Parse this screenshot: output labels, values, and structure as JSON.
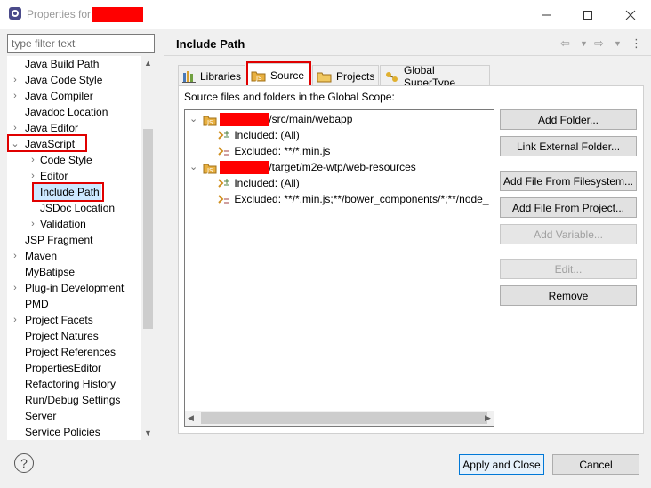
{
  "window": {
    "title": "Properties for",
    "minimize_icon": "minimize-icon",
    "maximize_icon": "maximize-icon",
    "close_icon": "close-icon"
  },
  "filter": {
    "placeholder": "type filter text"
  },
  "tree": {
    "items": [
      {
        "label": "Java Build Path",
        "expander": ""
      },
      {
        "label": "Java Code Style",
        "expander": ">"
      },
      {
        "label": "Java Compiler",
        "expander": ">"
      },
      {
        "label": "Javadoc Location",
        "expander": ""
      },
      {
        "label": "Java Editor",
        "expander": ">"
      },
      {
        "label": "JavaScript",
        "expander": "v",
        "highlighted": true
      },
      {
        "label": "Code Style",
        "expander": ">"
      },
      {
        "label": "Editor",
        "expander": ">"
      },
      {
        "label": "Include Path",
        "expander": "",
        "selected": true,
        "highlighted": true
      },
      {
        "label": "JSDoc Location",
        "expander": ""
      },
      {
        "label": "Validation",
        "expander": ">"
      },
      {
        "label": "JSP Fragment",
        "expander": ""
      },
      {
        "label": "Maven",
        "expander": ">"
      },
      {
        "label": "MyBatipse",
        "expander": ""
      },
      {
        "label": "Plug-in Development",
        "expander": ">"
      },
      {
        "label": "PMD",
        "expander": ""
      },
      {
        "label": "Project Facets",
        "expander": ">"
      },
      {
        "label": "Project Natures",
        "expander": ""
      },
      {
        "label": "Project References",
        "expander": ""
      },
      {
        "label": "PropertiesEditor",
        "expander": ""
      },
      {
        "label": "Refactoring History",
        "expander": ""
      },
      {
        "label": "Run/Debug Settings",
        "expander": ""
      },
      {
        "label": "Server",
        "expander": ""
      },
      {
        "label": "Service Policies",
        "expander": ""
      }
    ]
  },
  "page": {
    "title": "Include Path",
    "tabs": [
      {
        "label": "Libraries",
        "icon": "libraries-icon"
      },
      {
        "label": "Source",
        "icon": "source-folder-icon",
        "active": true
      },
      {
        "label": "Projects",
        "icon": "projects-folder-icon"
      },
      {
        "label": "Global SuperType",
        "icon": "supertype-icon"
      }
    ],
    "source_description": "Source files and folders in the Global Scope:",
    "source_entries": [
      {
        "path": "/src/main/webapp",
        "included": "Included: (All)",
        "excluded": "Excluded: **/*.min.js"
      },
      {
        "path": "/target/m2e-wtp/web-resources",
        "included": "Included: (All)",
        "excluded": "Excluded: **/*.min.js;**/bower_components/*;**/node_"
      }
    ],
    "buttons": {
      "add_folder": "Add Folder...",
      "link_external": "Link External Folder...",
      "add_file_fs": "Add File From Filesystem...",
      "add_file_project": "Add File From Project...",
      "add_variable": "Add Variable...",
      "edit": "Edit...",
      "remove": "Remove"
    }
  },
  "footer": {
    "help": "?",
    "apply_close": "Apply and Close",
    "cancel": "Cancel"
  },
  "colors": {
    "highlight": "#e00000",
    "selection": "#cce8ff",
    "redaction": "#ff0000"
  }
}
